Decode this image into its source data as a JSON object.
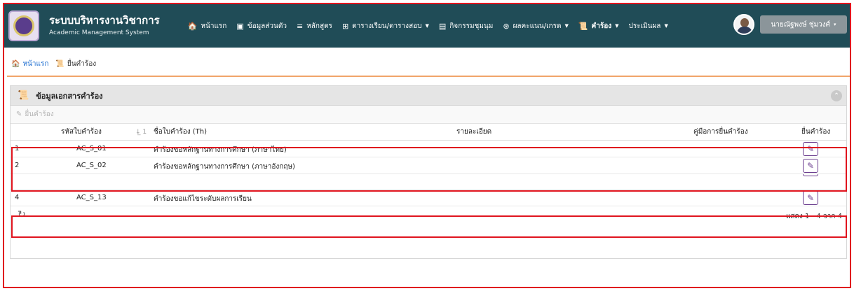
{
  "app": {
    "title": "ระบบบริหารงานวิชาการ",
    "subtitle": "Academic Management System"
  },
  "nav": {
    "items": [
      {
        "label": "หน้าแรก",
        "icon": "home-icon",
        "glyph": "🏠"
      },
      {
        "label": "ข้อมูลส่วนตัว",
        "icon": "id-card-icon",
        "glyph": "▣"
      },
      {
        "label": "หลักสูตร",
        "icon": "database-icon",
        "glyph": "≡"
      },
      {
        "label": "ตารางเรียน/ตารางสอบ",
        "icon": "table-icon",
        "glyph": "⊞",
        "dropdown": true
      },
      {
        "label": "กิจกรรมชุมนุม",
        "icon": "list-icon",
        "glyph": "▤"
      },
      {
        "label": "ผลคะแนน/เกรด",
        "icon": "chart-icon",
        "glyph": "⊛",
        "dropdown": true
      },
      {
        "label": "คำร้อง",
        "icon": "scroll-icon",
        "glyph": "📜",
        "dropdown": true,
        "active": true
      },
      {
        "label": "ประเมินผล",
        "icon": "",
        "glyph": "",
        "dropdown": true
      }
    ]
  },
  "user": {
    "name": "นายณัฐพงษ์ ชุ่มวงศ์",
    "caret": "▾"
  },
  "breadcrumb": {
    "home": "หน้าแรก",
    "current": "ยื่นคำร้อง"
  },
  "panel": {
    "title": "ข้อมูลเอกสารคำร้อง",
    "toolbar_label": "ยื่นคำร้อง",
    "collapse_glyph": "⌃"
  },
  "table": {
    "headers": {
      "code": "รหัสใบคำร้อง",
      "sort": "↓̲ 1",
      "name": "ชื่อใบคำร้อง (Th)",
      "detail": "รายละเอียด",
      "manual": "คู่มือการยื่นคำร้อง",
      "submit": "ยื่นคำร้อง"
    },
    "rows": [
      {
        "num": "1",
        "code": "AC_S_01",
        "name": "คำร้องขอหลักฐานทางการศึกษา (ภาษาไทย)"
      },
      {
        "num": "2",
        "code": "AC_S_02",
        "name": "คำร้องขอหลักฐานทางการศึกษา (ภาษาอังกฤษ)"
      },
      {
        "num": "4",
        "code": "AC_S_13",
        "name": "คำร้องขอแก้ไขระดับผลการเรียน"
      }
    ],
    "submit_glyph": "✎"
  },
  "footer": {
    "refresh_glyph": "↻",
    "count": "แสดง 1 - 4 จาก 4"
  },
  "colors": {
    "navbar": "#204c57",
    "highlight": "#e0141e",
    "accent": "#6a3c8e",
    "link": "#1f6fd1"
  }
}
